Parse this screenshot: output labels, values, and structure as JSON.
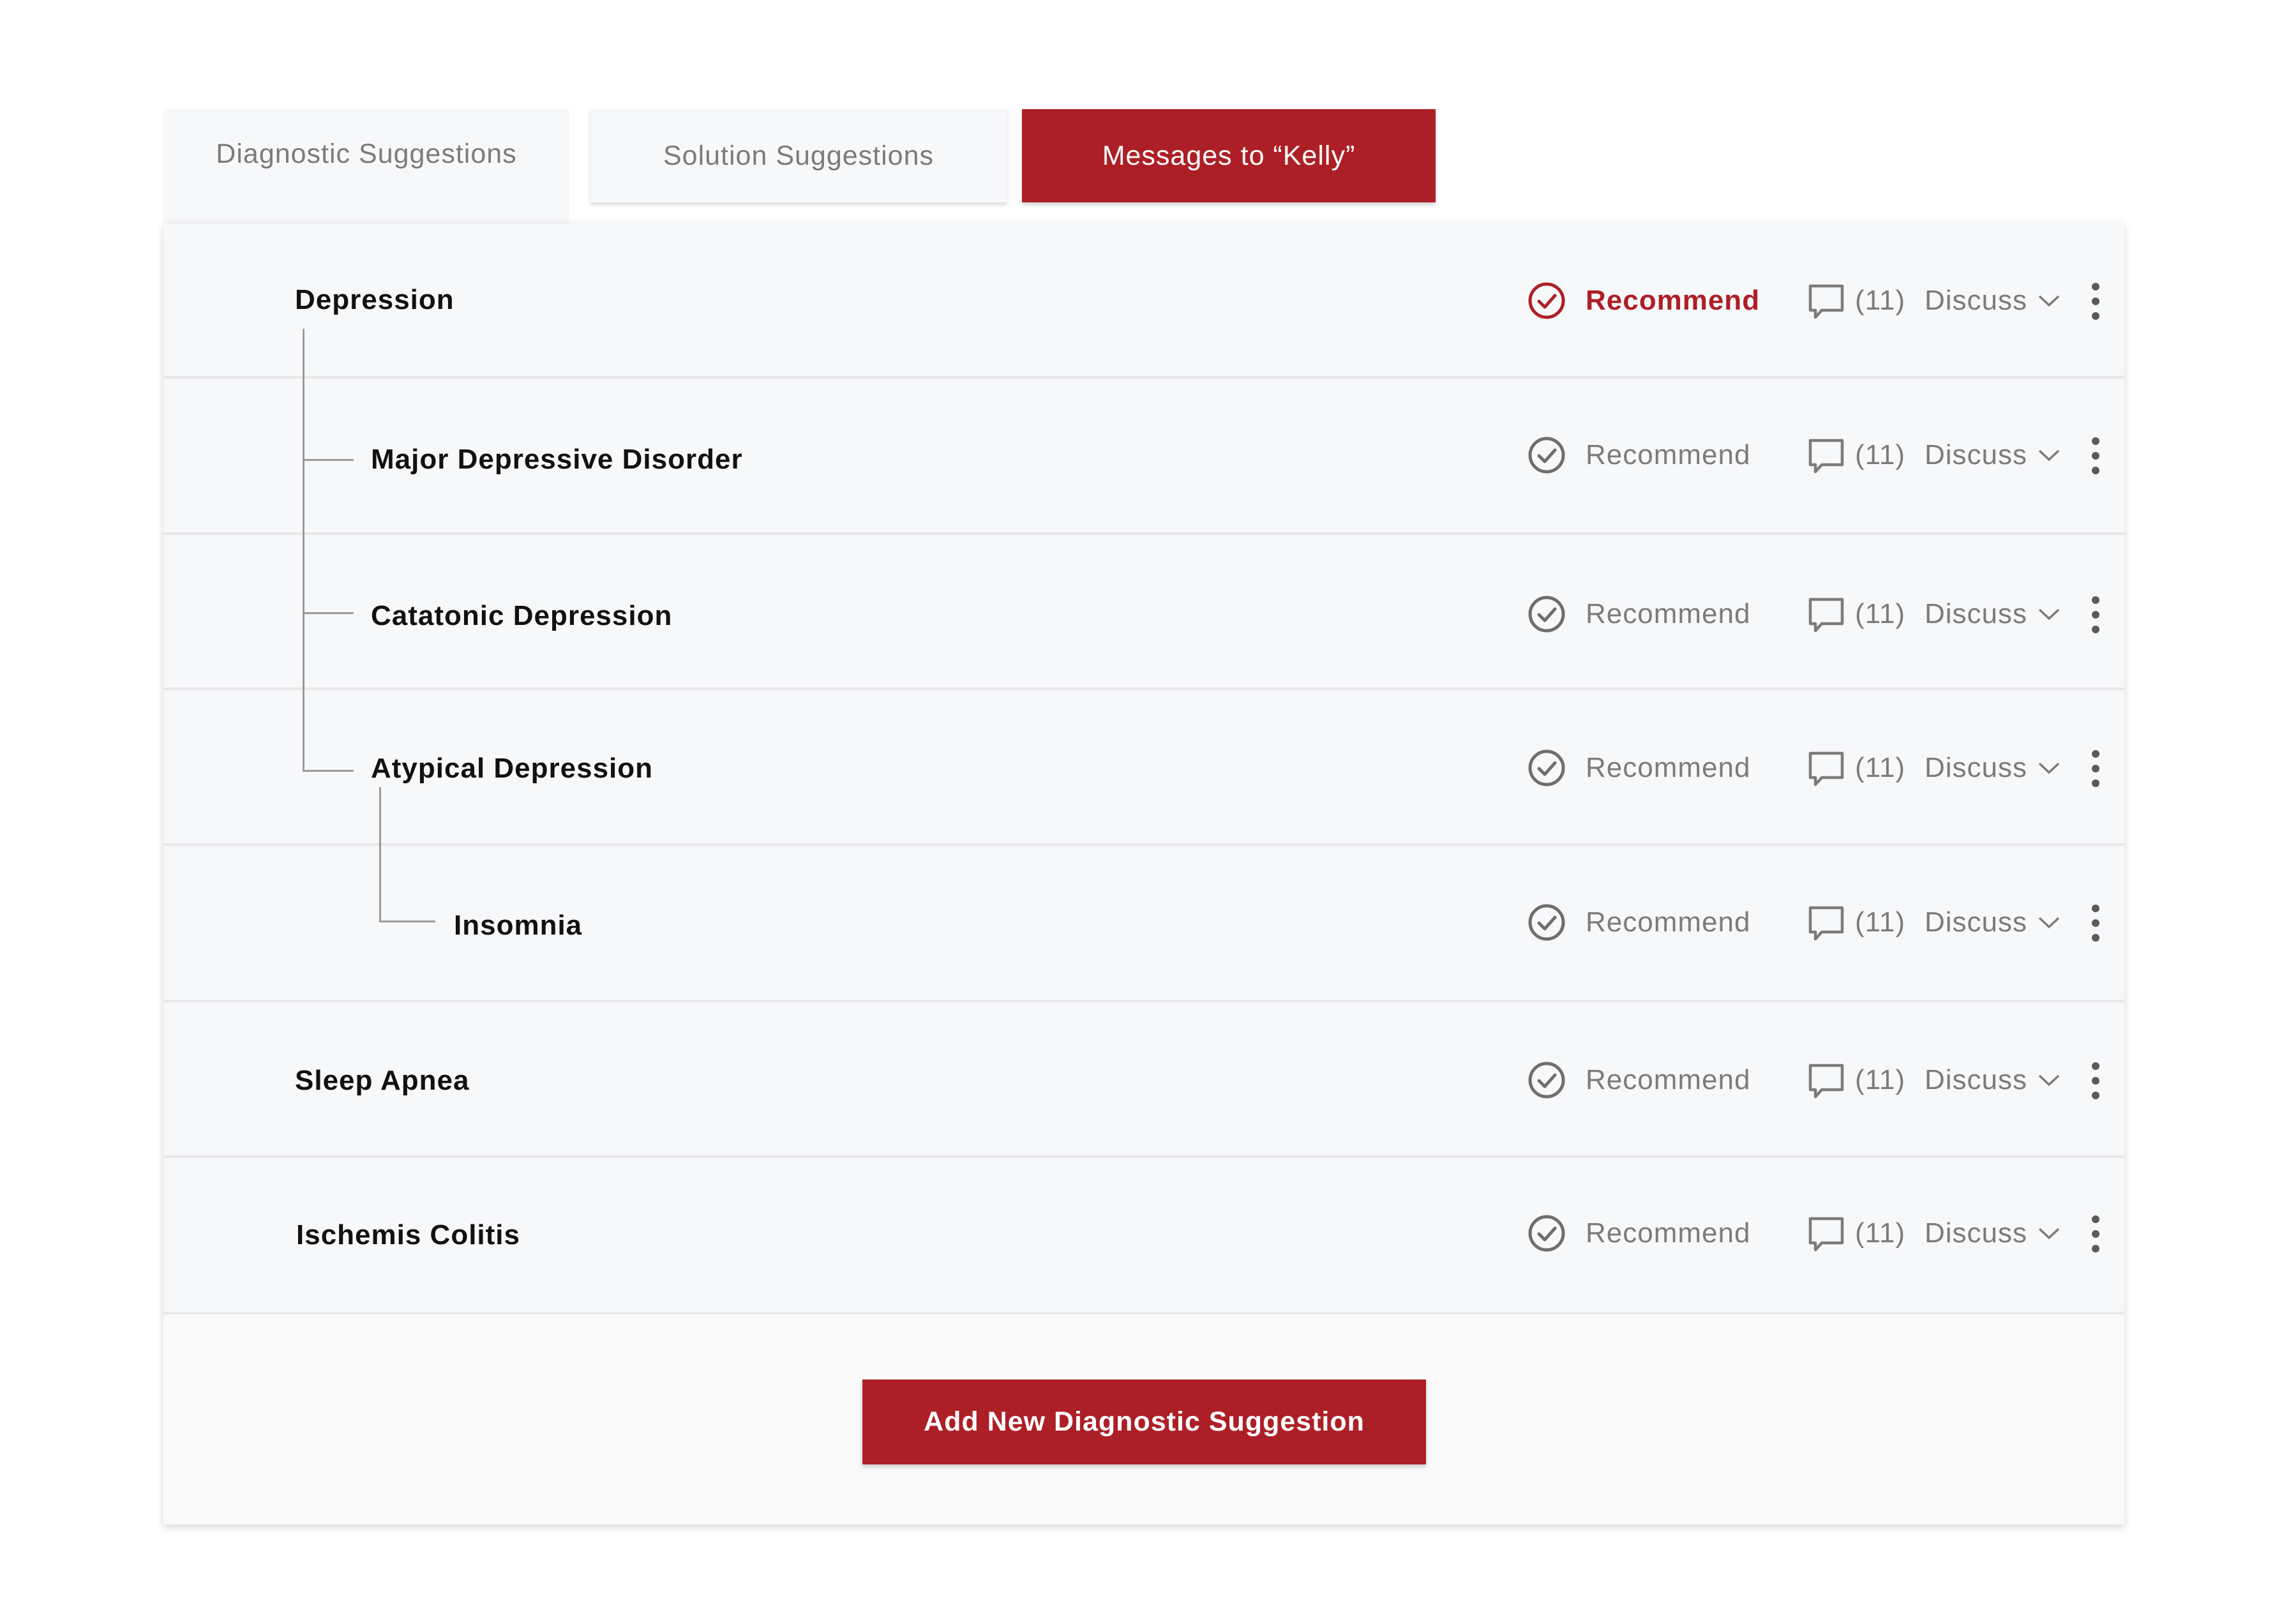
{
  "tabs": {
    "diagnostic": "Diagnostic Suggestions",
    "solution": "Solution Suggestions",
    "messages": "Messages to “Kelly”"
  },
  "actions": {
    "recommend": "Recommend",
    "discuss": "Discuss",
    "comment_count": "(11)"
  },
  "rows": [
    {
      "label": "Depression",
      "recommended": true
    },
    {
      "label": "Major Depressive Disorder",
      "recommended": false
    },
    {
      "label": "Catatonic Depression",
      "recommended": false
    },
    {
      "label": "Atypical Depression",
      "recommended": false
    },
    {
      "label": "Insomnia",
      "recommended": false
    },
    {
      "label": "Sleep Apnea",
      "recommended": false
    },
    {
      "label": "Ischemis Colitis",
      "recommended": false
    }
  ],
  "add_button": "Add New Diagnostic Suggestion",
  "colors": {
    "accent": "#ad1f26",
    "muted_text": "#7b7b7b",
    "row_background": "#f7f8fa"
  },
  "icons": {
    "recommend": "check-circle-icon",
    "discuss": "comment-bubble-icon",
    "expand": "chevron-down-icon",
    "menu": "more-vertical-icon"
  }
}
